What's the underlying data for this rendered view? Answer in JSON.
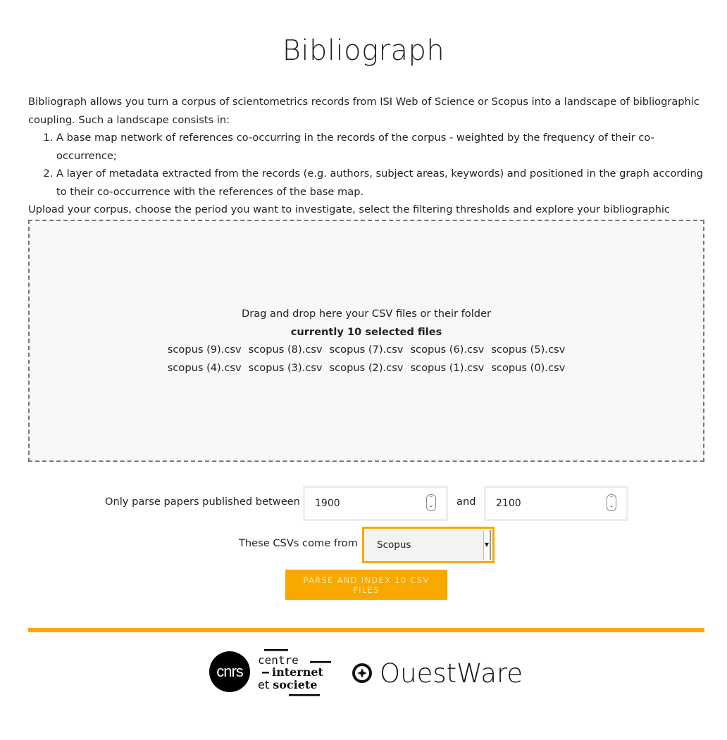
{
  "title": "Bibliograph",
  "intro": {
    "p1": "Bibliograph allows you turn a corpus of scientometrics records from ISI Web of Science or Scopus into a landscape of bibliographic coupling. Such a landscape consists in:",
    "items": [
      "A base map network of references co-occurring in the records of the corpus - weighted by the frequency of their co-occurrence;",
      "A layer of metadata extracted from the records (e.g. authors, subject areas, keywords) and positioned in the graph according to their co-occurrence with the references of the base map."
    ],
    "p2": "Upload your corpus, choose the period you want to investigate, select the filtering thresholds and explore your bibliographic landscape."
  },
  "dropzone": {
    "instruction": "Drag and drop here your CSV files or their folder",
    "count": "currently 10 selected files",
    "files": [
      "scopus (9).csv",
      "scopus (8).csv",
      "scopus (7).csv",
      "scopus (6).csv",
      "scopus (5).csv",
      "scopus (4).csv",
      "scopus (3).csv",
      "scopus (2).csv",
      "scopus (1).csv",
      "scopus (0).csv"
    ]
  },
  "form": {
    "period_label": "Only parse papers published between",
    "start_year": "1900",
    "and_label": "and",
    "end_year": "2100",
    "source_label": "These CSVs come from",
    "source_value": "Scopus",
    "submit_label": "PARSE AND INDEX 10 CSV FILES"
  },
  "footer": {
    "logos": [
      "cnrs",
      "centre internet et societe",
      "OuestWare"
    ]
  },
  "colors": {
    "accent": "#f9a800",
    "dropzone_bg": "#f8f8f8"
  }
}
